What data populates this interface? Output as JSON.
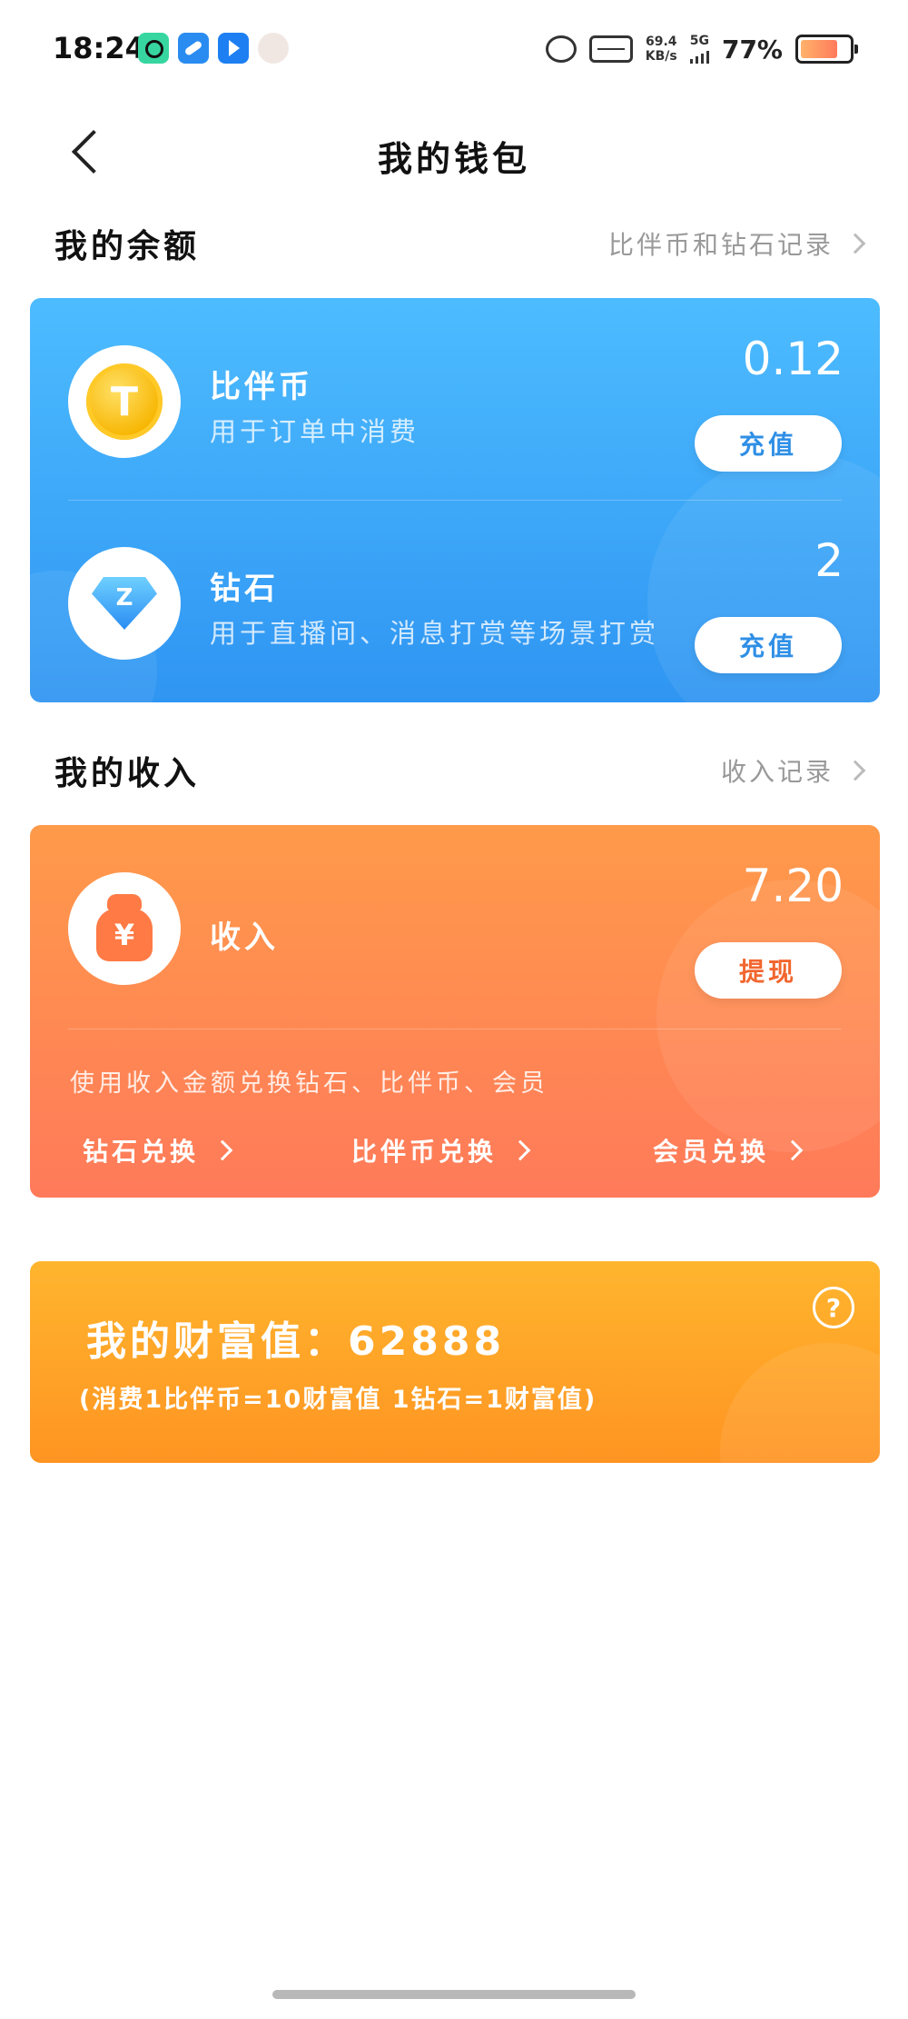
{
  "status_bar": {
    "time": "18:24",
    "net_speed_value": "69.4",
    "net_speed_unit": "KB/s",
    "signal_label": "5G",
    "battery_percent": "77%",
    "battery_level": 0.77,
    "icons": [
      "app-green-icon",
      "app-blue-icon",
      "app-play-icon",
      "avatar-icon",
      "alarm-icon",
      "pulse-icon"
    ]
  },
  "nav": {
    "back_icon": "chevron-left-icon",
    "title": "我的钱包"
  },
  "balance_section": {
    "title": "我的余额",
    "link": "比伴币和钻石记录",
    "rows": [
      {
        "icon": "coin-icon",
        "icon_letter": "T",
        "name": "比伴币",
        "desc": "用于订单中消费",
        "value": "0.12",
        "button": "充值"
      },
      {
        "icon": "diamond-icon",
        "icon_letter": "Z",
        "name": "钻石",
        "desc": "用于直播间、消息打赏等场景打赏",
        "value": "2",
        "button": "充值"
      }
    ],
    "accent": "#3aa2f7"
  },
  "income_section": {
    "title": "我的收入",
    "link": "收入记录",
    "name": "收入",
    "icon": "money-bag-icon",
    "icon_symbol": "¥",
    "value": "7.20",
    "button": "提现",
    "note": "使用收入金额兑换钻石、比伴币、会员",
    "exchanges": [
      "钻石兑换",
      "比伴币兑换",
      "会员兑换"
    ],
    "accent": "#ff8a4f"
  },
  "wealth": {
    "title": "我的财富值：62888",
    "note": "(消费1比伴币=10财富值 1钻石=1财富值)",
    "help_symbol": "?",
    "accent": "#ffa726"
  }
}
